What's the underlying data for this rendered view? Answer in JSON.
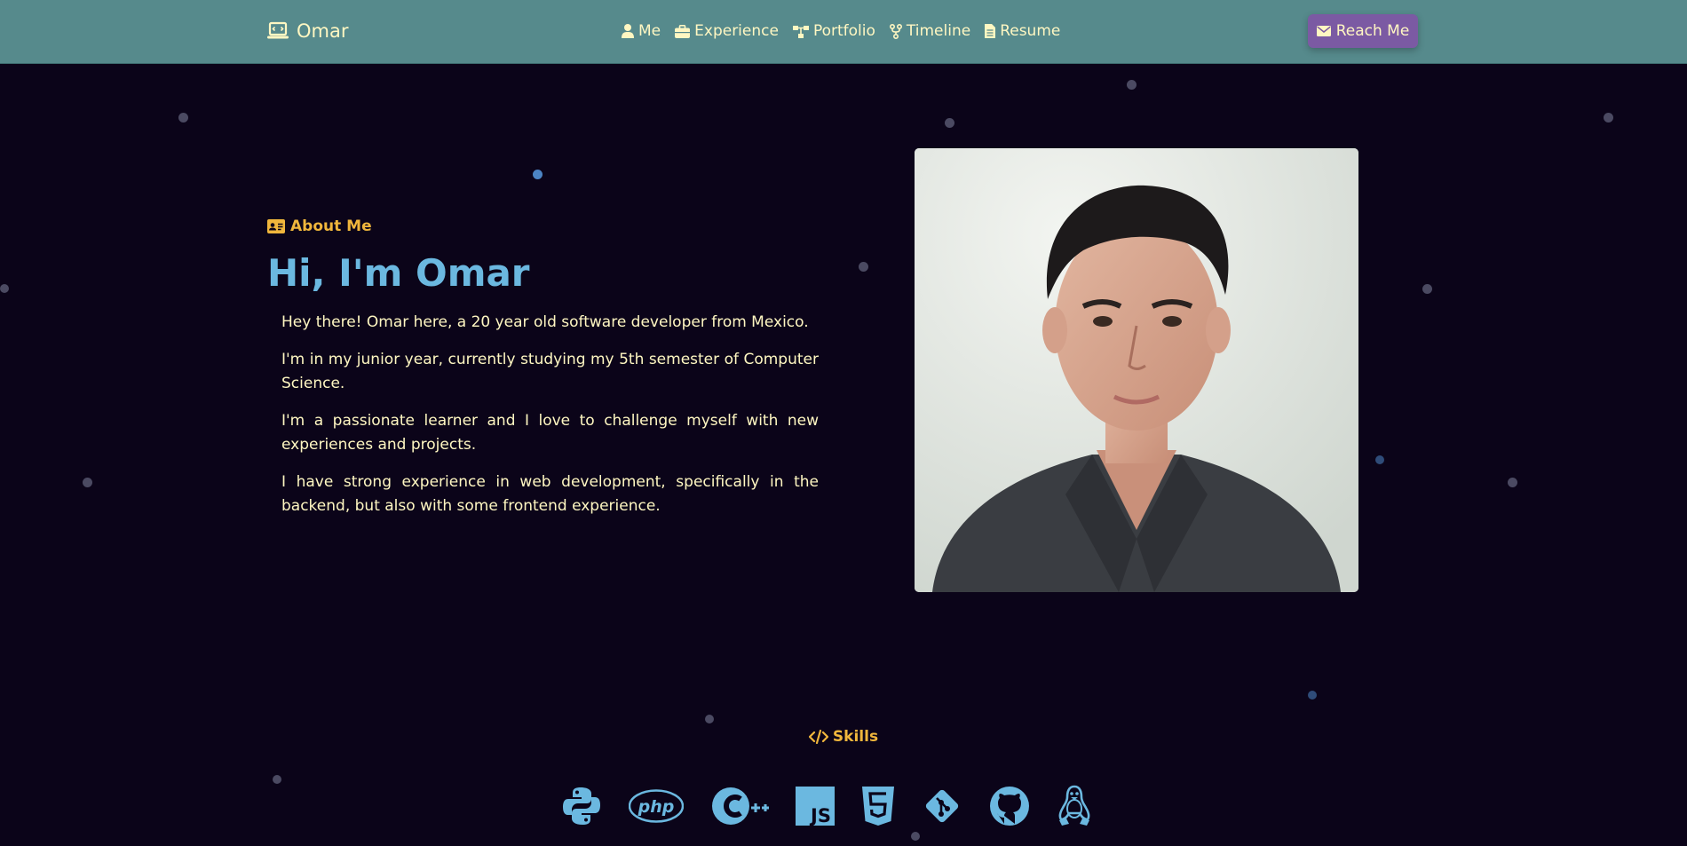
{
  "brand": {
    "name": "Omar",
    "icon": "laptop-code-icon"
  },
  "nav": {
    "items": [
      {
        "label": "Me",
        "icon": "user-icon"
      },
      {
        "label": "Experience",
        "icon": "briefcase-icon"
      },
      {
        "label": "Portfolio",
        "icon": "sitemap-icon"
      },
      {
        "label": "Timeline",
        "icon": "code-fork-icon"
      },
      {
        "label": "Resume",
        "icon": "file-icon"
      }
    ],
    "cta": {
      "label": "Reach Me",
      "icon": "envelope-icon"
    }
  },
  "about": {
    "eyebrow": "About Me",
    "title": "Hi, I'm Omar",
    "paragraphs": [
      "Hey there! Omar here, a 20 year old software developer from Mexico.",
      "I'm in my junior year, currently studying my 5th semester of Computer Science.",
      "I'm a passionate learner and I love to challenge myself with new experiences and projects.",
      "I have strong experience in web development, specifically in the backend, but also with some frontend experience."
    ]
  },
  "skills": {
    "title": "Skills",
    "icons": [
      "python-icon",
      "php-icon",
      "cplusplus-icon",
      "javascript-icon",
      "html5-icon",
      "git-icon",
      "github-icon",
      "linux-icon"
    ]
  },
  "colors": {
    "background": "#0b0419",
    "navbar": "#568a8c",
    "cream": "#fff7c2",
    "accent_orange": "#f0b63c",
    "accent_blue": "#6bb8e0",
    "button_purple": "#7b5aa3"
  }
}
